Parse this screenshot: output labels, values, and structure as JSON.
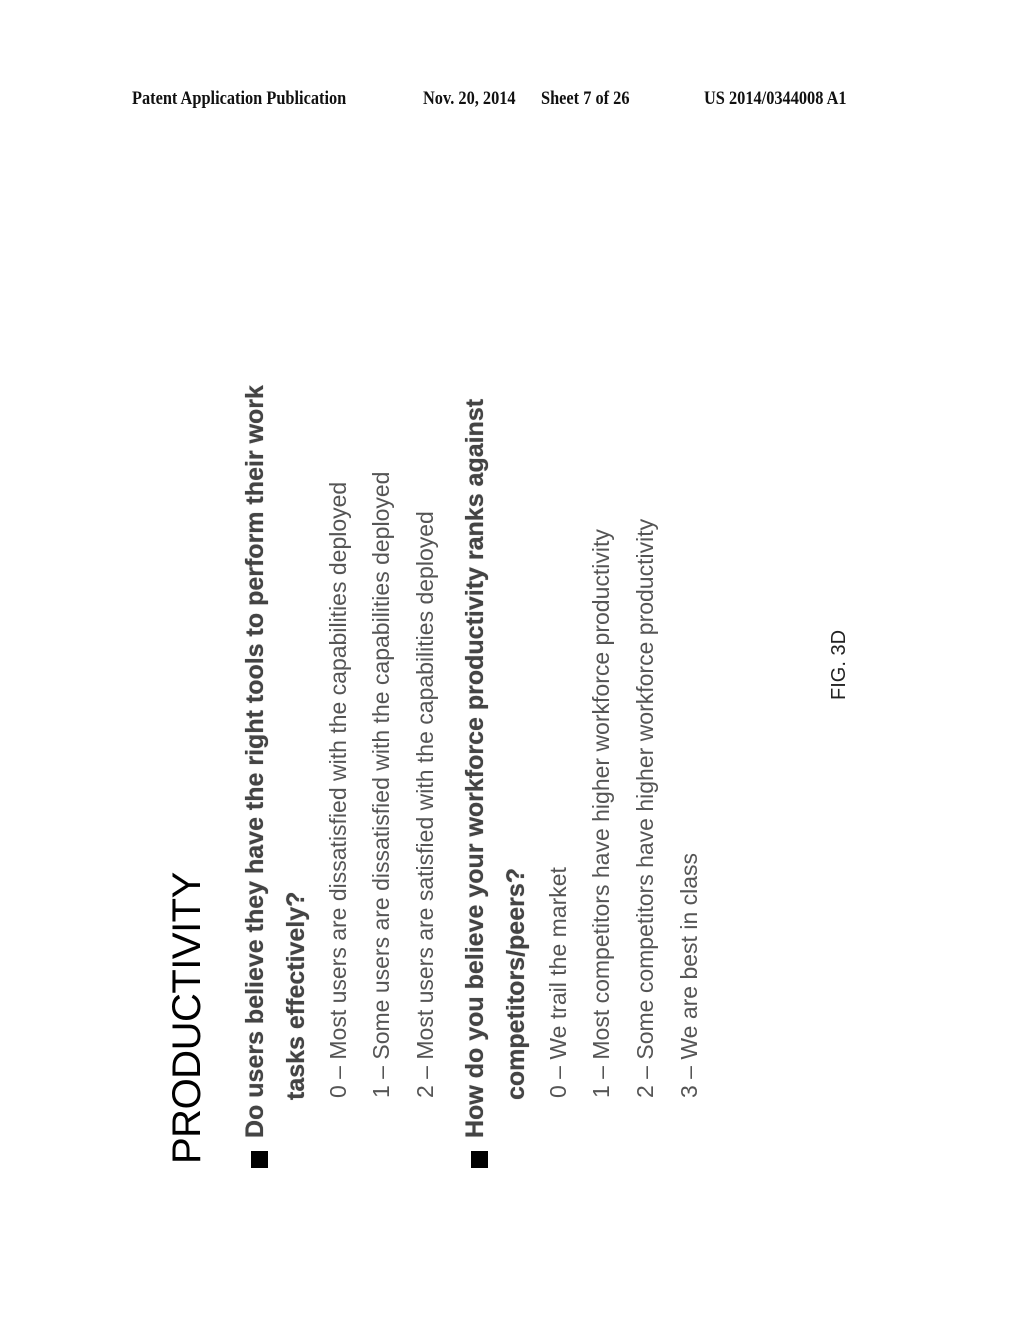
{
  "header": {
    "publication_type": "Patent Application Publication",
    "date": "Nov. 20, 2014",
    "sheet": "Sheet 7 of 26",
    "number": "US 2014/0344008 A1"
  },
  "figure": {
    "title": "PRODUCTIVITY",
    "questions": [
      {
        "lines": [
          "Do users believe they have the right tools to perform their work",
          "tasks effectively?"
        ],
        "options": [
          "0 – Most users are dissatisfied with the capabilities deployed",
          "1 – Some users are dissatisfied with the capabilities deployed",
          "2 – Most users are satisfied with the capabilities deployed"
        ]
      },
      {
        "lines": [
          "How do you believe your workforce productivity ranks against",
          "competitors/peers?"
        ],
        "options": [
          "0 – We trail the market",
          "1 – Most competitors have higher workforce productivity",
          "2 – Some competitors have higher workforce productivity",
          "3 – We are best in class"
        ]
      }
    ],
    "caption": "FIG. 3D"
  }
}
